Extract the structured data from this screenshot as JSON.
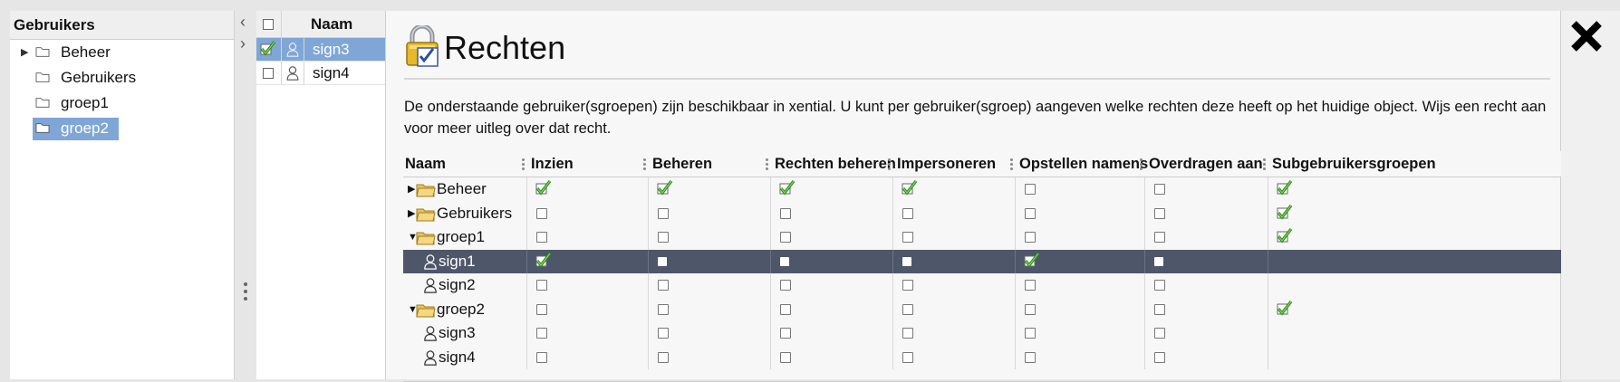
{
  "left_panel": {
    "title": "Gebruikers",
    "items": [
      {
        "label": "Beheer",
        "expandable": true,
        "selected": false
      },
      {
        "label": "Gebruikers",
        "expandable": false,
        "selected": false
      },
      {
        "label": "groep1",
        "expandable": false,
        "selected": false
      },
      {
        "label": "groep2",
        "expandable": false,
        "selected": true
      }
    ]
  },
  "middle_list": {
    "header": "Naam",
    "rows": [
      {
        "name": "sign3",
        "checked": true,
        "selected": true
      },
      {
        "name": "sign4",
        "checked": false,
        "selected": false
      }
    ]
  },
  "dialog": {
    "title": "Rechten",
    "description": "De onderstaande gebruiker(sgroepen) zijn beschikbaar in xential. U kunt per gebruiker(sgroep) aangeven welke rechten deze heeft op het huidige object. Wijs een recht aan voor meer uitleg over dat recht.",
    "columns": [
      "Naam",
      "Inzien",
      "Beheren",
      "Rechten beheren",
      "Impersoneren",
      "Opstellen namens",
      "Overdragen aan",
      "Subgebruikersgroepen"
    ],
    "rows": [
      {
        "name": "Beheer",
        "type": "group",
        "expander": "collapsed",
        "indent": 0,
        "selected": false,
        "rights": [
          "check",
          "check",
          "check",
          "check",
          "box",
          "box",
          "check"
        ]
      },
      {
        "name": "Gebruikers",
        "type": "group",
        "expander": "collapsed",
        "indent": 0,
        "selected": false,
        "rights": [
          "box",
          "box",
          "box",
          "box",
          "box",
          "box",
          "check"
        ]
      },
      {
        "name": "groep1",
        "type": "group",
        "expander": "expanded",
        "indent": 0,
        "selected": false,
        "rights": [
          "box",
          "box",
          "box",
          "box",
          "box",
          "box",
          "check"
        ]
      },
      {
        "name": "sign1",
        "type": "user",
        "expander": "none",
        "indent": 1,
        "selected": true,
        "rights": [
          "check",
          "box",
          "box",
          "box",
          "check",
          "box",
          "none"
        ]
      },
      {
        "name": "sign2",
        "type": "user",
        "expander": "none",
        "indent": 1,
        "selected": false,
        "rights": [
          "box",
          "box",
          "box",
          "box",
          "box",
          "box",
          "none"
        ]
      },
      {
        "name": "groep2",
        "type": "group",
        "expander": "expanded",
        "indent": 0,
        "selected": false,
        "rights": [
          "box",
          "box",
          "box",
          "box",
          "box",
          "box",
          "check"
        ]
      },
      {
        "name": "sign3",
        "type": "user",
        "expander": "none",
        "indent": 1,
        "selected": false,
        "rights": [
          "box",
          "box",
          "box",
          "box",
          "box",
          "box",
          "none"
        ]
      },
      {
        "name": "sign4",
        "type": "user",
        "expander": "none",
        "indent": 1,
        "selected": false,
        "rights": [
          "box",
          "box",
          "box",
          "box",
          "box",
          "box",
          "none"
        ]
      }
    ]
  },
  "icons": {
    "dialog_icon": "lock-check-icon",
    "close": "close-icon",
    "group": "folder-icon",
    "user": "user-icon",
    "check": "checkmark-icon"
  },
  "colors": {
    "selection_blue": "#7fa6d6",
    "selected_row": "#4e566a",
    "check_green": "#2e8a1c"
  }
}
